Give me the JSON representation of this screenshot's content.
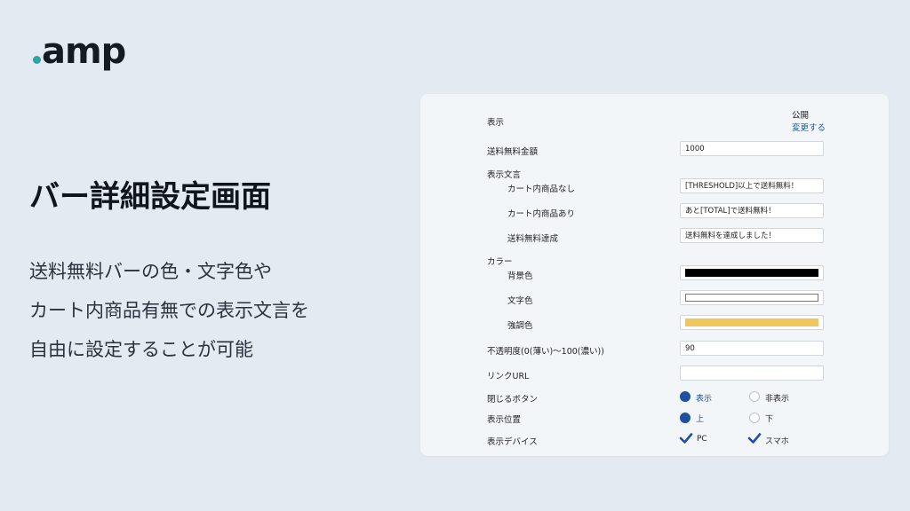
{
  "brand": {
    "logo": "amp",
    "accent": "#2aa7a0"
  },
  "slide": {
    "title": "バー詳細設定画面",
    "description": [
      "送料無料バーの色・文字色や",
      "カート内商品有無での表示文言を",
      "自由に設定することが可能"
    ]
  },
  "form": {
    "display": {
      "label": "表示",
      "status": "公開",
      "change_link": "変更する"
    },
    "free_shipping_amount": {
      "label": "送料無料金額",
      "value": "1000"
    },
    "display_text": {
      "label": "表示文言",
      "no_items": {
        "label": "カート内商品なし",
        "value": "[THRESHOLD]以上で送料無料！"
      },
      "with_items": {
        "label": "カート内商品あり",
        "value": "あと[TOTAL]で送料無料！"
      },
      "achieved": {
        "label": "送料無料達成",
        "value": "送料無料を達成しました！"
      }
    },
    "color": {
      "label": "カラー",
      "background": {
        "label": "背景色",
        "value": "#000000"
      },
      "text": {
        "label": "文字色",
        "value": "#ffffff"
      },
      "highlight": {
        "label": "強調色",
        "value": "#f0c75a"
      }
    },
    "opacity": {
      "label": "不透明度(0(薄い)〜100(濃い))",
      "value": "90"
    },
    "link_url": {
      "label": "リンクURL",
      "value": ""
    },
    "close_button": {
      "label": "閉じるボタン",
      "options": [
        "表示",
        "非表示"
      ],
      "selected": "表示"
    },
    "position": {
      "label": "表示位置",
      "options": [
        "上",
        "下"
      ],
      "selected": "上"
    },
    "devices": {
      "label": "表示デバイス",
      "options": [
        "PC",
        "スマホ"
      ],
      "checked": [
        "PC",
        "スマホ"
      ]
    }
  },
  "colors": {
    "primary": "#1e4fa0",
    "link": "#1f5aa6",
    "background": "#e4eaf1",
    "panel": "#f3f6f9"
  }
}
